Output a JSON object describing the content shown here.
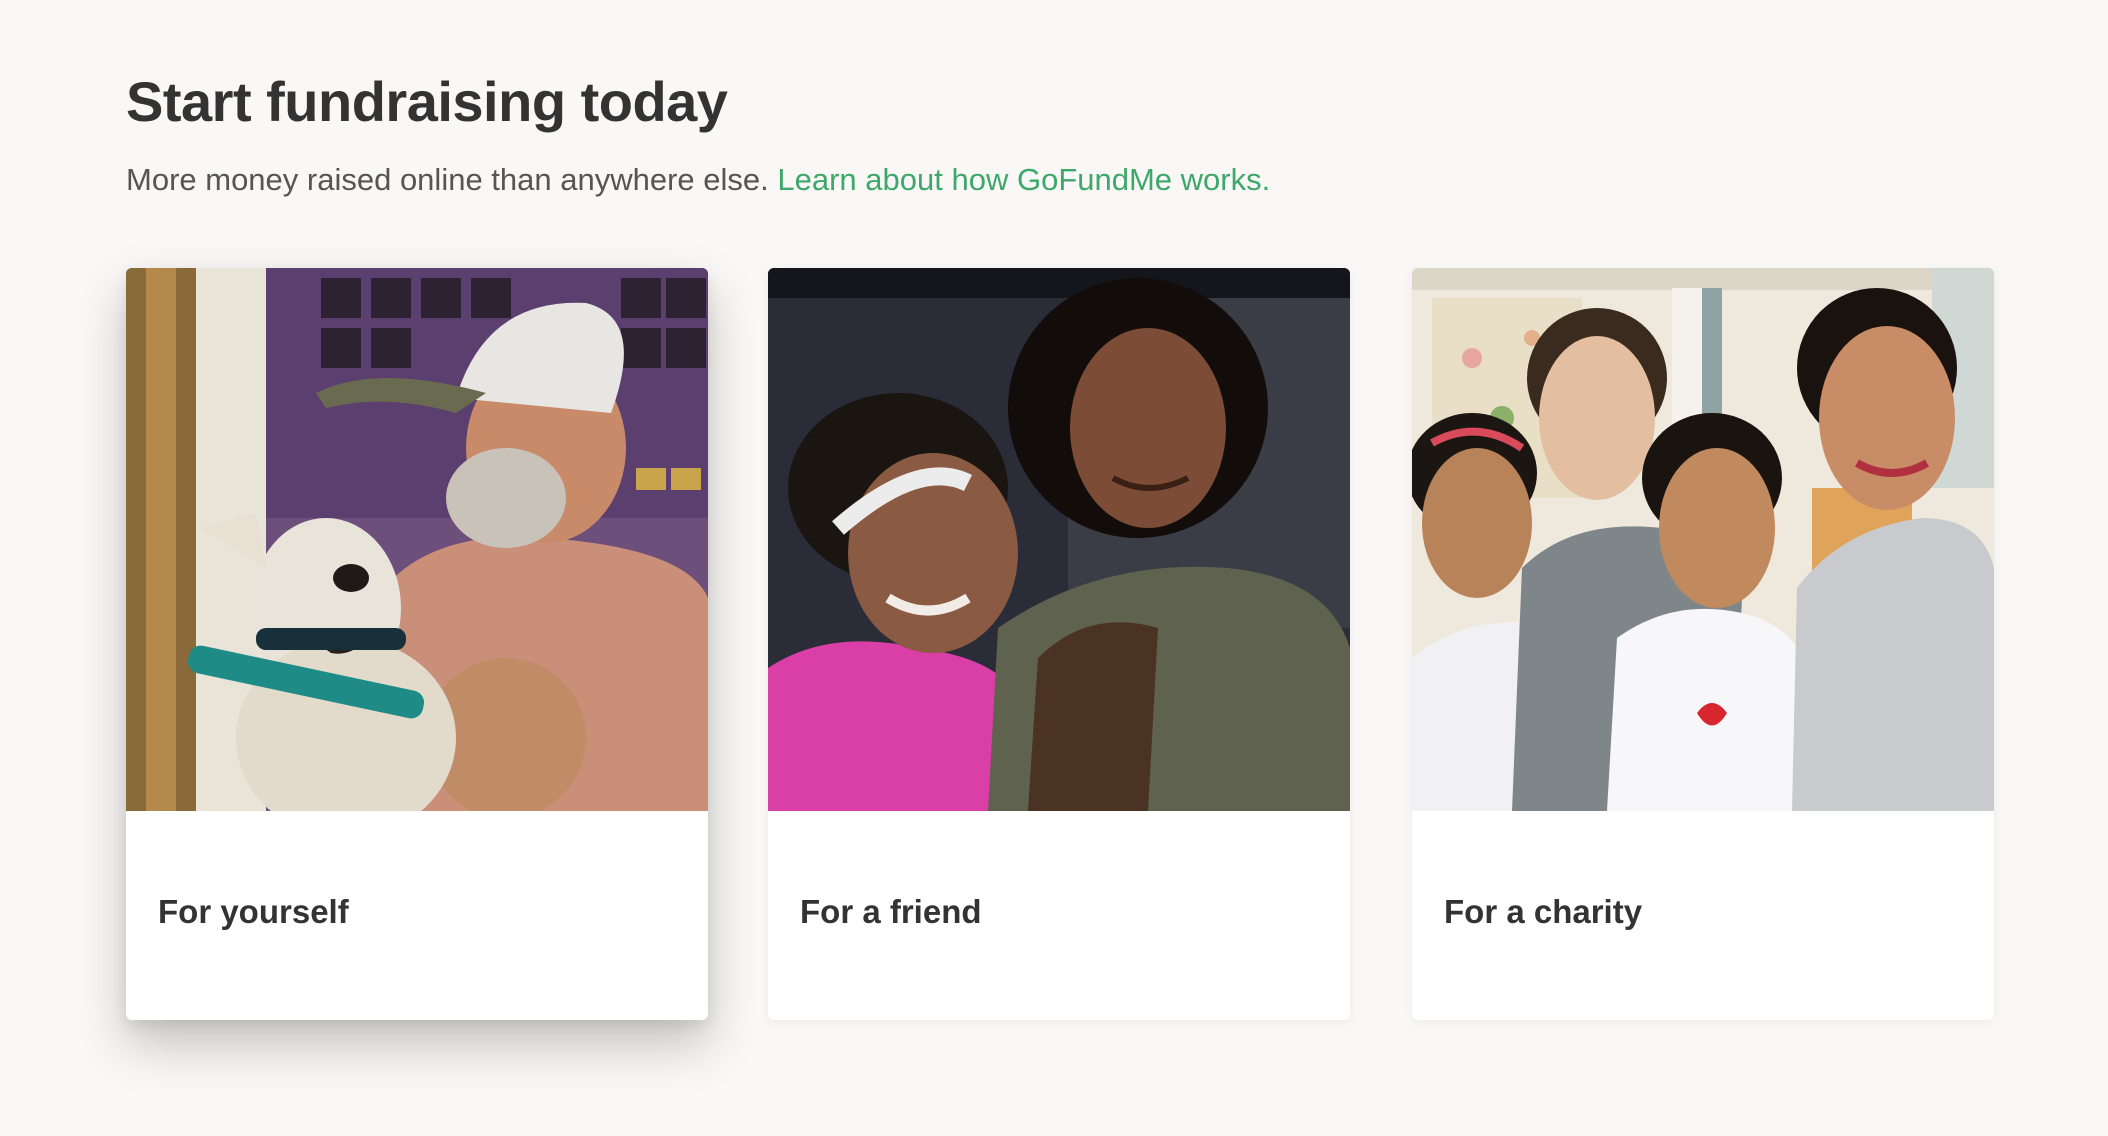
{
  "heading": "Start fundraising today",
  "subtitle": {
    "text": "More money raised online than anywhere else.",
    "link": "Learn about how GoFundMe works."
  },
  "colors": {
    "background": "#faf8f6",
    "link": "#3ea86a",
    "text": "#333333"
  },
  "cards": [
    {
      "label": "For yourself",
      "image": "man-with-dog-photo"
    },
    {
      "label": "For a friend",
      "image": "two-women-hugging-photo"
    },
    {
      "label": "For a charity",
      "image": "women-and-girls-group-photo"
    }
  ]
}
